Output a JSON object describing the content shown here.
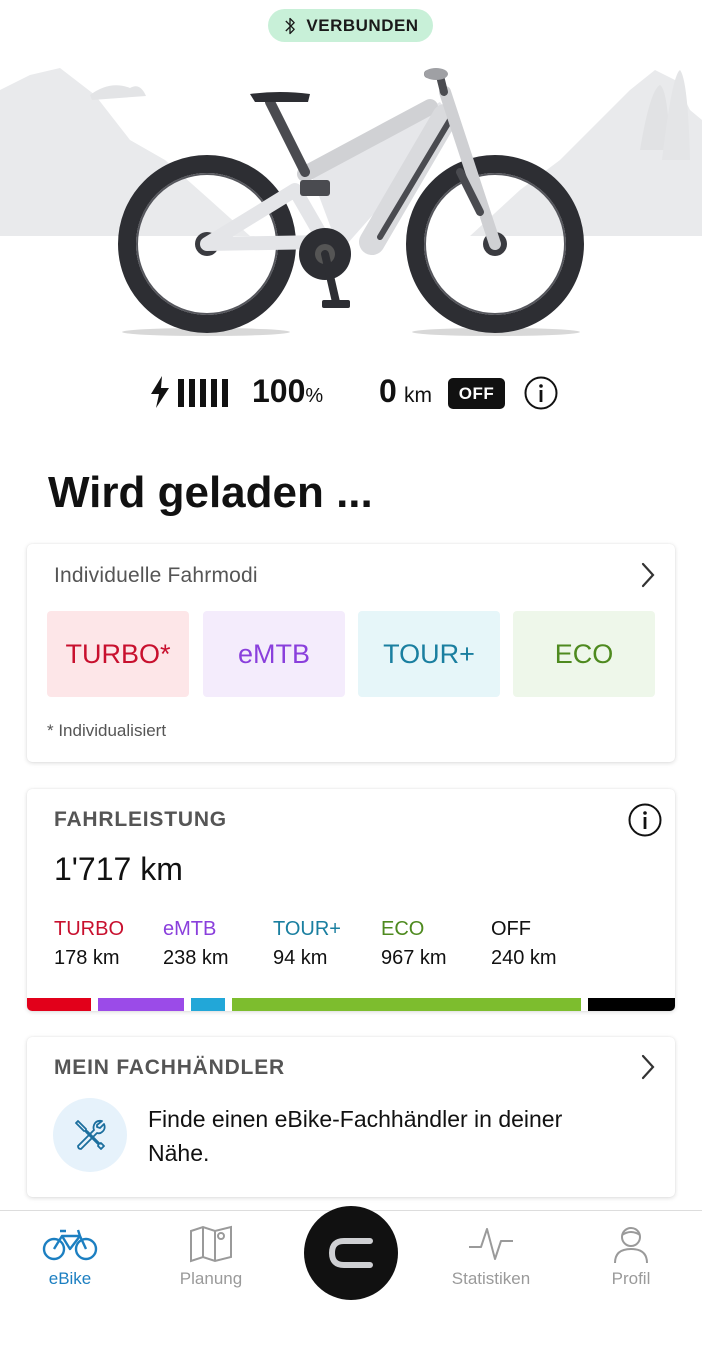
{
  "connection": {
    "label": "VERBUNDEN",
    "icon": "bluetooth-icon"
  },
  "status": {
    "battery_percent": "100",
    "percent_sign": "%",
    "battery_level_fraction": 1.0,
    "range_value": "0",
    "range_unit": "km",
    "mode_badge": "OFF"
  },
  "page_title": "Wird geladen ...",
  "modes_card": {
    "title": "Individuelle Fahrmodi",
    "tiles": [
      {
        "label": "TURBO*",
        "color": "#c8102e",
        "bg": "#fde6e8"
      },
      {
        "label": "eMTB",
        "color": "#8a3fdc",
        "bg": "#f4ecfc"
      },
      {
        "label": "TOUR+",
        "color": "#1a7fa0",
        "bg": "#e6f6f9"
      },
      {
        "label": "ECO",
        "color": "#4e8a1f",
        "bg": "#eef7ea"
      }
    ],
    "note": "* Individualisiert"
  },
  "stats_card": {
    "title": "FAHRLEISTUNG",
    "total": "1'717 km",
    "modes": [
      {
        "name": "TURBO",
        "km": "178 km",
        "color": "#c8102e",
        "bar_color": "#e2001a",
        "km_value": 178
      },
      {
        "name": "eMTB",
        "km": "238 km",
        "color": "#8a3fdc",
        "bar_color": "#9b4be8",
        "km_value": 238
      },
      {
        "name": "TOUR+",
        "km": "94 km",
        "color": "#1a7fa0",
        "bar_color": "#22a7d8",
        "km_value": 94
      },
      {
        "name": "ECO",
        "km": "967 km",
        "color": "#4e8a1f",
        "bar_color": "#7dbd2e",
        "km_value": 967
      },
      {
        "name": "OFF",
        "km": "240 km",
        "color": "#111111",
        "bar_color": "#000000",
        "km_value": 240
      }
    ]
  },
  "dealer_card": {
    "title": "MEIN FACHHÄNDLER",
    "text": "Finde einen eBike-Fachhändler in deiner Nähe."
  },
  "bottom_nav": {
    "items": [
      {
        "label": "eBike",
        "icon": "bike-icon",
        "active": true
      },
      {
        "label": "Planung",
        "icon": "map-icon",
        "active": false
      },
      {
        "label": "Statistiken",
        "icon": "activity-icon",
        "active": false
      },
      {
        "label": "Profil",
        "icon": "profile-icon",
        "active": false
      }
    ],
    "center_icon": "bosch-logo-icon"
  },
  "colors": {
    "accent": "#1c7fc1",
    "connected_bg": "#c8f0d8"
  }
}
